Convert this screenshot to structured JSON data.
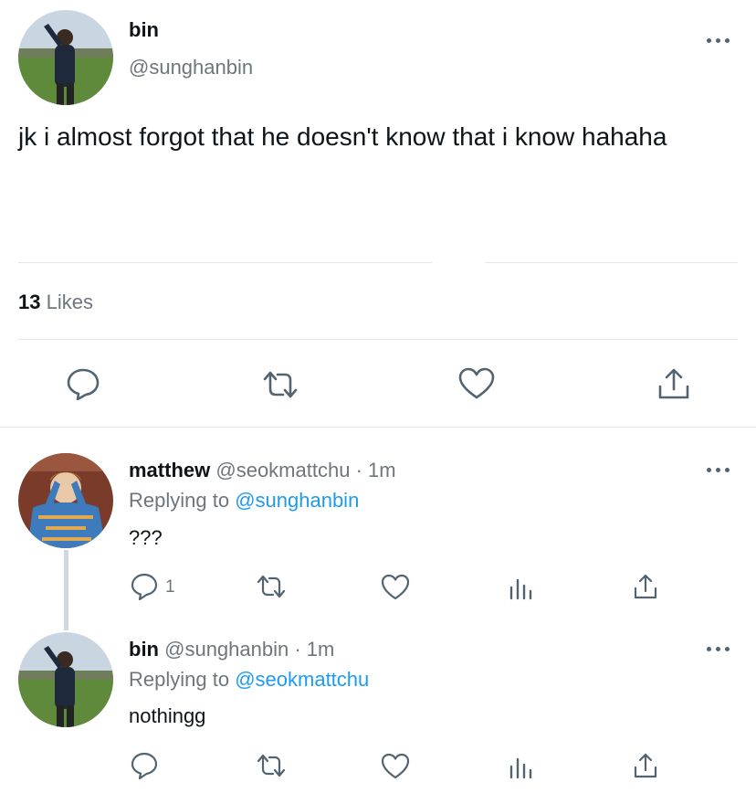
{
  "main_tweet": {
    "display_name": "bin",
    "handle": "@sunghanbin",
    "text": "jk i almost forgot that he doesn't know that i know hahaha",
    "likes_count": "13",
    "likes_label": "Likes"
  },
  "replies": [
    {
      "display_name": "matthew",
      "handle": "@seokmattchu",
      "time": "· 1m",
      "replying_label": "Replying to",
      "replying_to": "@sunghanbin",
      "text": "???",
      "reply_count": "1"
    },
    {
      "display_name": "bin",
      "handle": "@sunghanbin",
      "time": "· 1m",
      "replying_label": "Replying to",
      "replying_to": "@seokmattchu",
      "text": "nothingg",
      "reply_count": ""
    }
  ],
  "icons": {
    "more": "more-horizontal-icon",
    "reply": "reply-icon",
    "retweet": "retweet-icon",
    "like": "heart-icon",
    "analytics": "analytics-icon",
    "share": "share-icon"
  },
  "colors": {
    "text": "#0f1419",
    "secondary": "#6e767d",
    "link": "#1d9bf0",
    "divider": "#e3e6e8",
    "icon": "#536471"
  }
}
